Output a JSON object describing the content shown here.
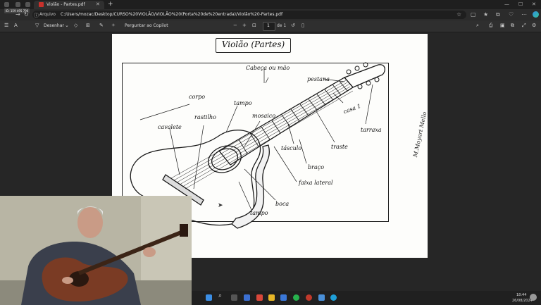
{
  "browser": {
    "tab_title": "Violão - Partes.pdf",
    "url_label": "Arquivo",
    "url": "C:/Users/mozac/Desktop/CURSO%20VIOLÃO/VIOLÃO%20(Porta%20de%20entrada)/Violão%20-Partes.pdf",
    "badge": "ID: 159 495 796"
  },
  "pdf_toolbar": {
    "draw_label": "Desenhar",
    "copilot_label": "Perguntar ao Copilot",
    "page_number": "1",
    "page_of": "de 1"
  },
  "document": {
    "title": "Violão (Partes)",
    "labels": {
      "cabeca_ou_mao": "Cabeça ou mão",
      "corpo": "corpo",
      "tampo_top": "tampo",
      "cavalete": "cavalete",
      "rastilho": "rastilho",
      "mosaico": "mosaico",
      "pestana": "pestana",
      "casa": "casa 1",
      "tarraxa": "tarraxa",
      "trastes": "traste",
      "tasculo": "tásculo",
      "braco": "braço",
      "faixa_lateral": "faixa lateral",
      "boca": "boca",
      "tampo_bottom": "tampo"
    },
    "signature": "M.Moyart Mello"
  },
  "taskbar": {
    "time": "18:44",
    "date": "26/08/2024"
  }
}
